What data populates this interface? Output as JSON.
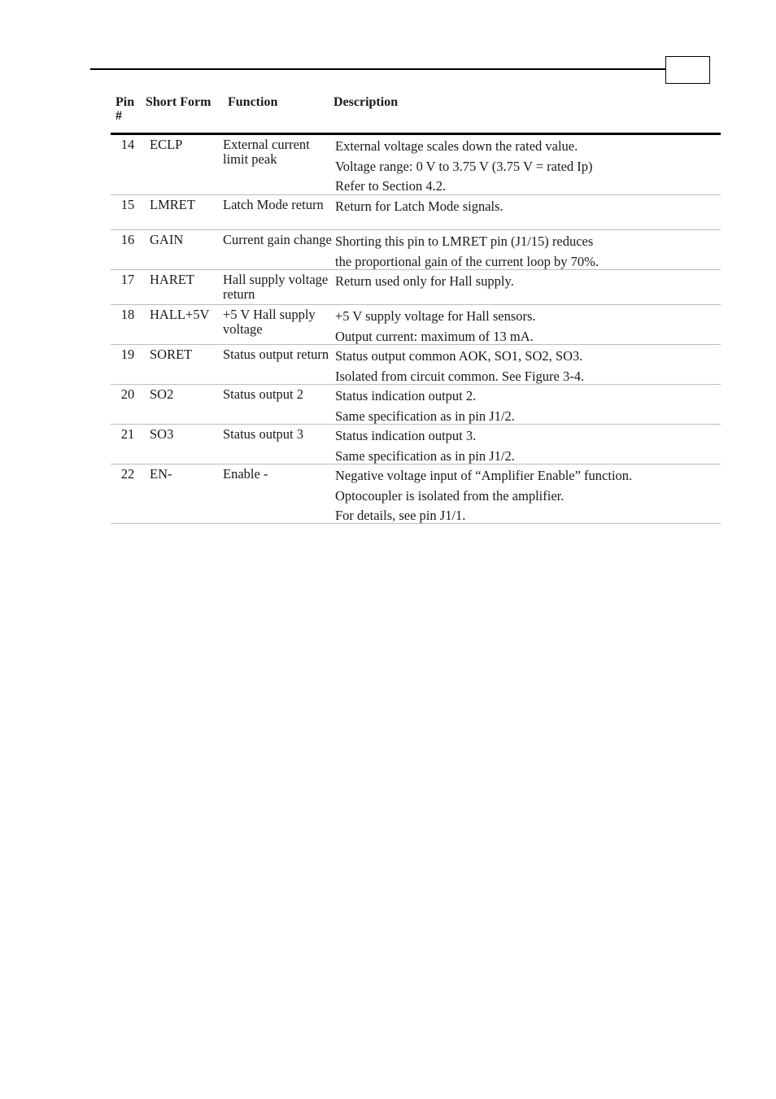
{
  "header": {
    "page_number": ""
  },
  "table": {
    "columns": [
      "Pin #",
      "Short Form",
      "Function",
      "Description"
    ],
    "column_header_pin_line1": "Pin",
    "column_header_pin_line2": "#",
    "rows": [
      {
        "pin": "14",
        "short": "ECLP",
        "function": "External current limit peak",
        "description": [
          "External voltage scales down the rated value.",
          "Voltage range: 0 V to 3.75 V (3.75 V = rated Ip)",
          "Refer to Section 4.2."
        ]
      },
      {
        "pin": "15",
        "short": "LMRET",
        "function": "Latch Mode return",
        "description": [
          "Return for Latch Mode signals."
        ]
      },
      {
        "pin": "16",
        "short": "GAIN",
        "function": "Current gain change",
        "description": [
          "Shorting this pin to LMRET pin (J1/15) reduces",
          "the proportional gain of the current loop by 70%."
        ]
      },
      {
        "pin": "17",
        "short": "HARET",
        "function": "Hall supply voltage return",
        "description": [
          "Return used only for Hall supply."
        ]
      },
      {
        "pin": "18",
        "short": "HALL+5V",
        "function": "+5 V Hall supply voltage",
        "description": [
          "+5 V supply voltage for Hall sensors.",
          "Output current: maximum of 13 mA."
        ]
      },
      {
        "pin": "19",
        "short": "SORET",
        "function": "Status output return",
        "description": [
          "Status output common AOK, SO1, SO2, SO3.",
          "Isolated from circuit common. See Figure 3-4."
        ]
      },
      {
        "pin": "20",
        "short": "SO2",
        "function": "Status output 2",
        "description": [
          "Status indication output 2.",
          "Same specification as in pin J1/2."
        ]
      },
      {
        "pin": "21",
        "short": "SO3",
        "function": "Status output 3",
        "description": [
          "Status indication output 3.",
          "Same specification as in pin J1/2."
        ]
      },
      {
        "pin": "22",
        "short": "EN-",
        "function": "Enable -",
        "description": [
          "Negative voltage input of “Amplifier Enable” function.",
          "Optocoupler is isolated from the amplifier.",
          "For details, see pin J1/1."
        ]
      }
    ]
  }
}
